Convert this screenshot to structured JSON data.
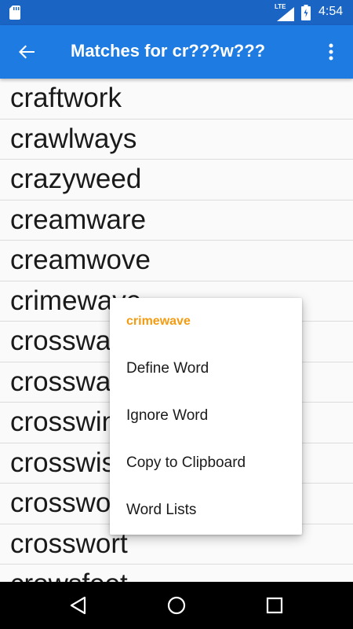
{
  "status_bar": {
    "network": "LTE",
    "time": "4:54",
    "icons": [
      "sd-card-icon",
      "signal-icon",
      "battery-icon"
    ]
  },
  "app_bar": {
    "title": "Matches for cr???w???",
    "back_icon": "arrow-back-icon",
    "overflow_icon": "more-vert-icon"
  },
  "words": [
    "craftwork",
    "crawlways",
    "crazyweed",
    "creamware",
    "creamwove",
    "crimewave",
    "crossways",
    "crosswalk",
    "crosswind",
    "crosswise",
    "crossword",
    "crosswort",
    "crowsfeet"
  ],
  "context_menu": {
    "header": "crimewave",
    "items": [
      "Define Word",
      "Ignore Word",
      "Copy to Clipboard",
      "Word Lists"
    ]
  },
  "nav_bar": {
    "icons": [
      "nav-back-icon",
      "nav-home-icon",
      "nav-recents-icon"
    ]
  },
  "colors": {
    "status_bar": "#1a64c4",
    "app_bar": "#1e7be2",
    "menu_header": "#f39c12",
    "divider": "#dcdcdc"
  }
}
